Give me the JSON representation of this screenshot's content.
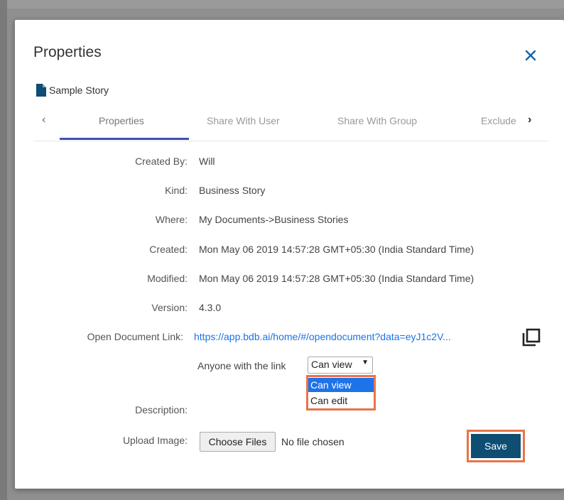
{
  "dialog": {
    "title": "Properties",
    "document_name": "Sample Story"
  },
  "tabs": [
    {
      "label": "Properties",
      "active": true
    },
    {
      "label": "Share With User"
    },
    {
      "label": "Share With Group"
    },
    {
      "label": "Exclude"
    }
  ],
  "fields": {
    "created_by": {
      "label": "Created By:",
      "value": "Will"
    },
    "kind": {
      "label": "Kind:",
      "value": "Business Story"
    },
    "where": {
      "label": "Where:",
      "value": "My Documents->Business Stories"
    },
    "created": {
      "label": "Created:",
      "value": "Mon May 06 2019 14:57:28 GMT+05:30 (India Standard Time)"
    },
    "modified": {
      "label": "Modified:",
      "value": "Mon May 06 2019 14:57:28 GMT+05:30 (India Standard Time)"
    },
    "version": {
      "label": "Version:",
      "value": "4.3.0"
    },
    "open_link": {
      "label": "Open Document Link:",
      "value": "https://app.bdb.ai/home/#/opendocument?data=eyJ1c2V..."
    },
    "description": {
      "label": "Description:"
    },
    "upload": {
      "label": "Upload Image:",
      "button": "Choose Files",
      "status": "No file chosen"
    }
  },
  "link_access": {
    "prefix": "Anyone with the link",
    "selected": "Can view",
    "options": [
      "Can view",
      "Can edit"
    ]
  },
  "save_label": "Save",
  "colors": {
    "accent": "#3f51b5",
    "link": "#1a73e8",
    "highlight": "#e8734a",
    "save": "#0f4d73",
    "option_selected": "#1e73e8"
  }
}
